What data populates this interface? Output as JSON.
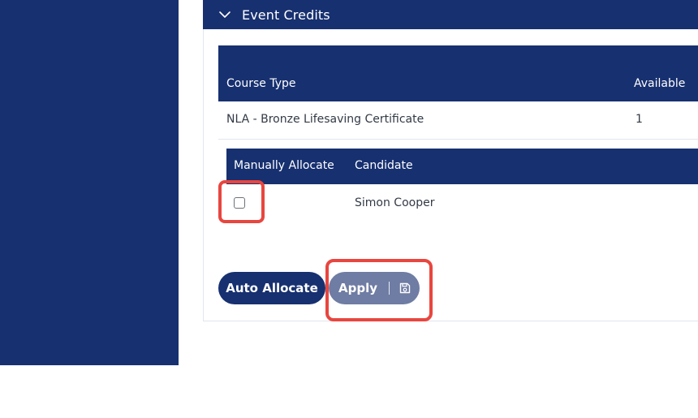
{
  "panel": {
    "title": "Event Credits"
  },
  "table": {
    "columns": [
      "Course Type",
      "Available"
    ],
    "rows": [
      {
        "course_type": "NLA - Bronze Lifesaving Certificate",
        "available": "1"
      }
    ]
  },
  "allocation": {
    "columns": [
      "Manually Allocate",
      "Candidate"
    ],
    "rows": [
      {
        "checked": false,
        "candidate": "Simon Cooper"
      }
    ]
  },
  "buttons": {
    "auto_allocate": "Auto Allocate",
    "apply": "Apply"
  },
  "icons": {
    "header_toggle": "chevron-down-icon",
    "apply_icon": "save-icon"
  },
  "colors": {
    "brand": "#173070",
    "apply_button": "#6f7ca3",
    "highlight": "#e8463f"
  }
}
